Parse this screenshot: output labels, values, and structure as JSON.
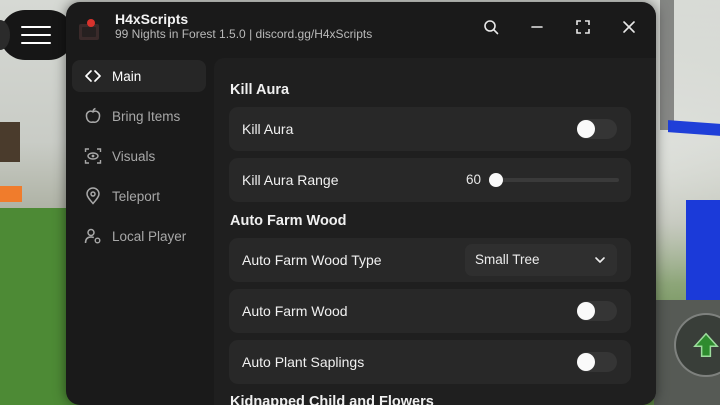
{
  "window": {
    "title": "H4xScripts",
    "subtitle": "99 Nights in Forest 1.5.0 | discord.gg/H4xScripts"
  },
  "sidebar": {
    "items": [
      {
        "label": "Main",
        "icon": "code-icon",
        "active": true
      },
      {
        "label": "Bring Items",
        "icon": "apple-icon",
        "active": false
      },
      {
        "label": "Visuals",
        "icon": "eye-scan-icon",
        "active": false
      },
      {
        "label": "Teleport",
        "icon": "location-pin-icon",
        "active": false
      },
      {
        "label": "Local Player",
        "icon": "user-settings-icon",
        "active": false
      }
    ]
  },
  "main": {
    "section_kill_aura": "Kill Aura",
    "kill_aura_toggle_label": "Kill Aura",
    "kill_aura_enabled": false,
    "kill_aura_range_label": "Kill Aura Range",
    "kill_aura_range_value": "60",
    "section_auto_farm_wood": "Auto Farm Wood",
    "auto_farm_wood_type_label": "Auto Farm Wood Type",
    "auto_farm_wood_type_value": "Small Tree",
    "auto_farm_wood_label": "Auto Farm Wood",
    "auto_farm_wood_enabled": false,
    "auto_plant_saplings_label": "Auto Plant Saplings",
    "auto_plant_saplings_enabled": false,
    "section_next_partial": "Kidnapped Child and Flowers"
  },
  "colors": {
    "window_bg": "#1a1a1a",
    "content_bg": "#1f1f1f",
    "row_bg": "#282828",
    "accent_red": "#d8322c"
  }
}
